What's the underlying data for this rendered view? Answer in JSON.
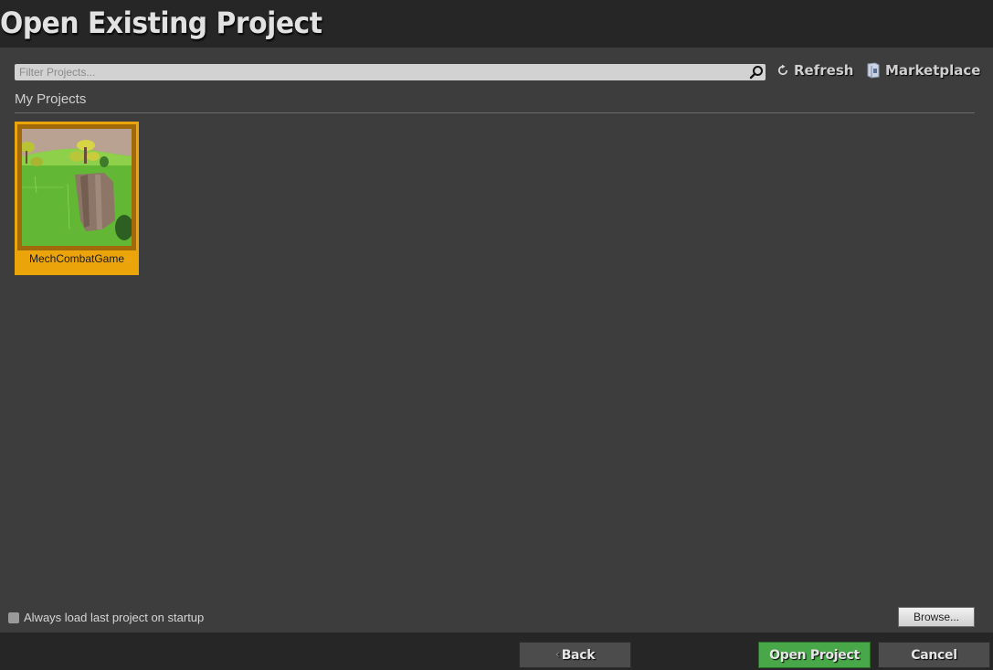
{
  "window": {
    "title": "Open Existing Project"
  },
  "toolbar": {
    "filter_placeholder": "Filter Projects...",
    "filter_value": "",
    "refresh_label": "Refresh",
    "marketplace_label": "Marketplace"
  },
  "projects": {
    "section_label": "My Projects",
    "items": [
      {
        "name": "MechCombatGame",
        "selected": true
      }
    ]
  },
  "options": {
    "always_load_label": "Always load last project on startup",
    "always_load_checked": false,
    "browse_label": "Browse..."
  },
  "footer": {
    "back_label": "Back",
    "open_label": "Open Project",
    "cancel_label": "Cancel"
  },
  "colors": {
    "selection": "#eba50b",
    "open_button": "#48a748",
    "panel": "#3d3d3d",
    "background": "#262626"
  }
}
